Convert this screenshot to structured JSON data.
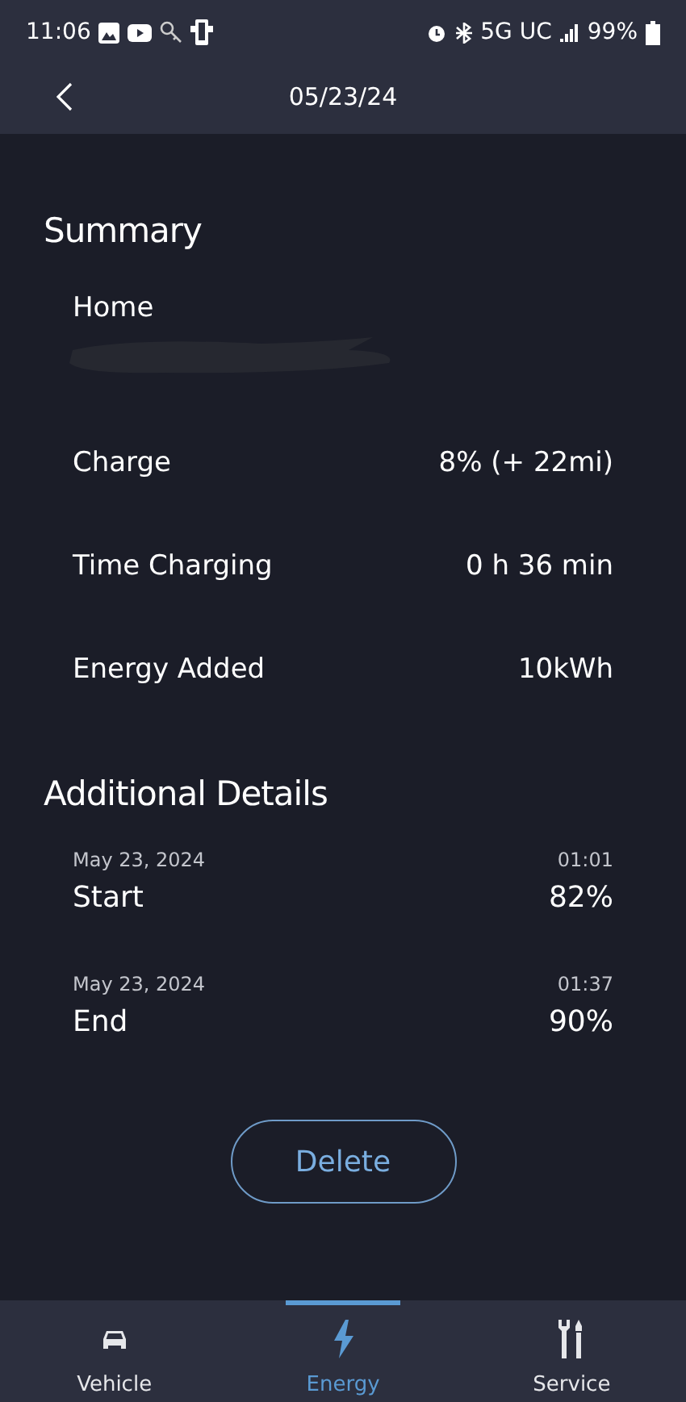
{
  "status_bar": {
    "time": "11:06",
    "network": "5G UC",
    "battery": "99%"
  },
  "header": {
    "title": "05/23/24"
  },
  "summary": {
    "title": "Summary",
    "location": "Home",
    "rows": [
      {
        "label": "Charge",
        "value": "8% (+ 22mi)"
      },
      {
        "label": "Time Charging",
        "value": "0 h 36 min"
      },
      {
        "label": "Energy Added",
        "value": "10kWh"
      }
    ]
  },
  "details": {
    "title": "Additional Details",
    "rows": [
      {
        "date": "May 23, 2024",
        "time": "01:01",
        "label": "Start",
        "value": "82%"
      },
      {
        "date": "May 23, 2024",
        "time": "01:37",
        "label": "End",
        "value": "90%"
      }
    ]
  },
  "delete_button": "Delete",
  "nav": [
    {
      "label": "Vehicle",
      "kind": "car",
      "selected": false
    },
    {
      "label": "Energy",
      "kind": "bolt",
      "selected": true
    },
    {
      "label": "Service",
      "kind": "tools",
      "selected": false
    }
  ]
}
